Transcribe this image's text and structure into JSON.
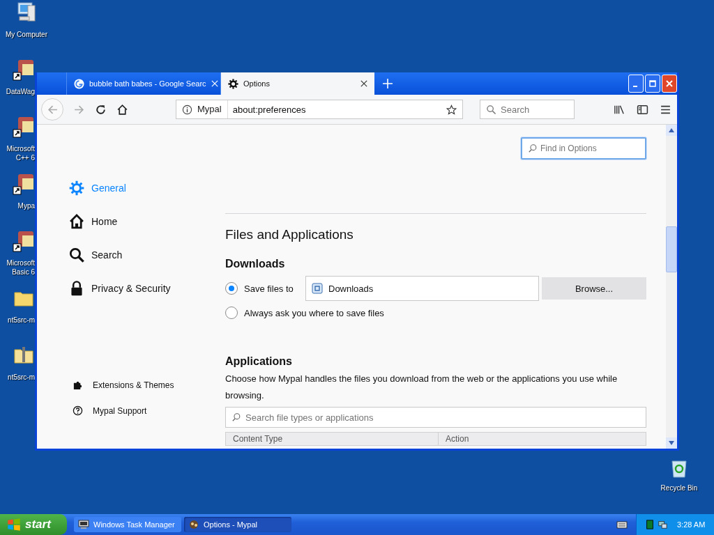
{
  "desktop_icons": [
    {
      "label": "My Computer",
      "kind": "computer"
    },
    {
      "label": "DataWag",
      "kind": "shortcut"
    },
    {
      "label": "Microsoft C++ 6",
      "kind": "shortcut"
    },
    {
      "label": "Mypa",
      "kind": "shortcut"
    },
    {
      "label": "Microsoft Basic 6",
      "kind": "shortcut"
    },
    {
      "label": "nt5src-m",
      "kind": "folder"
    },
    {
      "label": "nt5src-m",
      "kind": "zip"
    }
  ],
  "recycle_bin": {
    "label": "Recycle Bin"
  },
  "window": {
    "tabs": [
      {
        "title": "bubble bath babes - Google Searc",
        "selected": false,
        "kind": "google"
      },
      {
        "title": "Options",
        "selected": true,
        "kind": "gear"
      }
    ],
    "toolbar": {
      "identity": "Mypal",
      "url": "about:preferences",
      "search_placeholder": "Search"
    },
    "find_placeholder": "Find in Options",
    "nav": [
      {
        "label": "General",
        "selected": true,
        "kind": "gear"
      },
      {
        "label": "Home",
        "selected": false,
        "kind": "home"
      },
      {
        "label": "Search",
        "selected": false,
        "kind": "search"
      },
      {
        "label": "Privacy & Security",
        "selected": false,
        "kind": "lock"
      }
    ],
    "nav_bottom": [
      {
        "label": "Extensions & Themes",
        "kind": "puzzle"
      },
      {
        "label": "Mypal Support",
        "kind": "help"
      }
    ],
    "section_title": "Files and Applications",
    "downloads": {
      "heading": "Downloads",
      "options": [
        {
          "label": "Save files to",
          "selected": true
        },
        {
          "label": "Always ask you where to save files",
          "selected": false
        }
      ],
      "folder": "Downloads",
      "browse": "Browse..."
    },
    "applications": {
      "heading": "Applications",
      "description": "Choose how Mypal handles the files you download from the web or the applications you use while browsing.",
      "search_placeholder": "Search file types or applications",
      "columns": [
        "Content Type",
        "Action"
      ]
    }
  },
  "taskbar": {
    "start": "start",
    "tasks": [
      {
        "label": "Windows Task Manager",
        "selected": false,
        "kind": "monitor"
      },
      {
        "label": "Options - Mypal",
        "selected": true,
        "kind": "app"
      }
    ],
    "clock": "3:28 AM"
  }
}
